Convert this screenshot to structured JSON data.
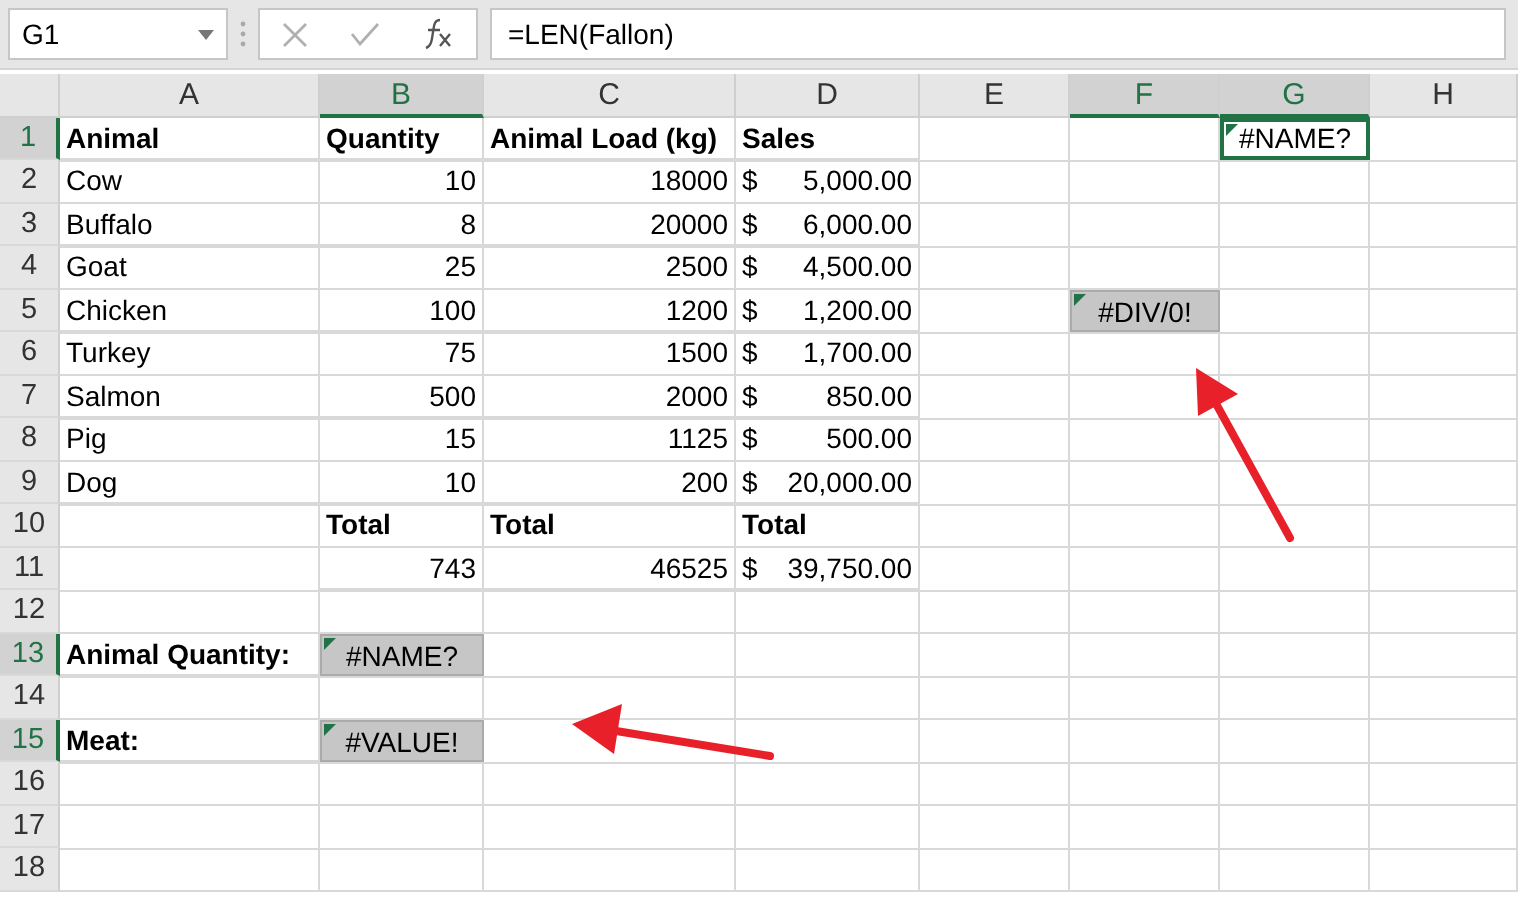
{
  "name_box": {
    "value": "G1"
  },
  "formula_bar": {
    "value": "=LEN(Fallon)"
  },
  "columns": [
    {
      "label": "A",
      "selected": false
    },
    {
      "label": "B",
      "selected": true
    },
    {
      "label": "C",
      "selected": false
    },
    {
      "label": "D",
      "selected": false
    },
    {
      "label": "E",
      "selected": false
    },
    {
      "label": "F",
      "selected": true
    },
    {
      "label": "G",
      "selected": true
    },
    {
      "label": "H",
      "selected": false
    }
  ],
  "rows": [
    {
      "number": "1",
      "selected": true,
      "cells": [
        {
          "kind": "label",
          "text": "Animal",
          "selected": false
        },
        {
          "kind": "label",
          "text": "Quantity",
          "selected": false
        },
        {
          "kind": "label",
          "text": "Animal Load (kg)",
          "selected": false
        },
        {
          "kind": "label",
          "text": "Sales",
          "selected": false
        },
        {
          "selected": false
        },
        {
          "selected": false
        },
        {
          "kind": "error",
          "text": "#NAME?",
          "selected": true
        },
        {
          "selected": false
        }
      ]
    },
    {
      "number": "2",
      "selected": false,
      "cells": [
        {
          "kind": "text",
          "text": "Cow",
          "selected": false
        },
        {
          "kind": "number",
          "text": "10",
          "selected": false
        },
        {
          "kind": "number",
          "text": "18000",
          "selected": false
        },
        {
          "kind": "currency",
          "symbol": "$",
          "text": "5,000.00",
          "selected": false
        },
        {
          "selected": false
        },
        {
          "selected": false
        },
        {
          "selected": false
        },
        {
          "selected": false
        }
      ]
    },
    {
      "number": "3",
      "selected": false,
      "cells": [
        {
          "kind": "text",
          "text": "Buffalo",
          "selected": false
        },
        {
          "kind": "number",
          "text": "8",
          "selected": false
        },
        {
          "kind": "number",
          "text": "20000",
          "selected": false
        },
        {
          "kind": "currency",
          "symbol": "$",
          "text": "6,000.00",
          "selected": false
        },
        {
          "selected": false
        },
        {
          "selected": false
        },
        {
          "selected": false
        },
        {
          "selected": false
        }
      ]
    },
    {
      "number": "4",
      "selected": false,
      "cells": [
        {
          "kind": "text",
          "text": "Goat",
          "selected": false
        },
        {
          "kind": "number",
          "text": "25",
          "selected": false
        },
        {
          "kind": "number",
          "text": "2500",
          "selected": false
        },
        {
          "kind": "currency",
          "symbol": "$",
          "text": "4,500.00",
          "selected": false
        },
        {
          "selected": false
        },
        {
          "selected": false
        },
        {
          "selected": false
        },
        {
          "selected": false
        }
      ]
    },
    {
      "number": "5",
      "selected": false,
      "cells": [
        {
          "kind": "text",
          "text": "Chicken",
          "selected": false
        },
        {
          "kind": "number",
          "text": "100",
          "selected": false
        },
        {
          "kind": "number",
          "text": "1200",
          "selected": false
        },
        {
          "kind": "currency",
          "symbol": "$",
          "text": "1,200.00",
          "selected": false
        },
        {
          "selected": false
        },
        {
          "kind": "error",
          "text": "#DIV/0!",
          "selected": false
        },
        {
          "selected": false
        },
        {
          "selected": false
        }
      ]
    },
    {
      "number": "6",
      "selected": false,
      "cells": [
        {
          "kind": "text",
          "text": "Turkey",
          "selected": false
        },
        {
          "kind": "number",
          "text": "75",
          "selected": false
        },
        {
          "kind": "number",
          "text": "1500",
          "selected": false
        },
        {
          "kind": "currency",
          "symbol": "$",
          "text": "1,700.00",
          "selected": false
        },
        {
          "selected": false
        },
        {
          "selected": false
        },
        {
          "selected": false
        },
        {
          "selected": false
        }
      ]
    },
    {
      "number": "7",
      "selected": false,
      "cells": [
        {
          "kind": "text",
          "text": "Salmon",
          "selected": false
        },
        {
          "kind": "number",
          "text": "500",
          "selected": false
        },
        {
          "kind": "number",
          "text": "2000",
          "selected": false
        },
        {
          "kind": "currency",
          "symbol": "$",
          "text": "850.00",
          "selected": false
        },
        {
          "selected": false
        },
        {
          "selected": false
        },
        {
          "selected": false
        },
        {
          "selected": false
        }
      ]
    },
    {
      "number": "8",
      "selected": false,
      "cells": [
        {
          "kind": "text",
          "text": "Pig",
          "selected": false
        },
        {
          "kind": "number",
          "text": "15",
          "selected": false
        },
        {
          "kind": "number",
          "text": "1125",
          "selected": false
        },
        {
          "kind": "currency",
          "symbol": "$",
          "text": "500.00",
          "selected": false
        },
        {
          "selected": false
        },
        {
          "selected": false
        },
        {
          "selected": false
        },
        {
          "selected": false
        }
      ]
    },
    {
      "number": "9",
      "selected": false,
      "cells": [
        {
          "kind": "text",
          "text": "Dog",
          "selected": false
        },
        {
          "kind": "number",
          "text": "10",
          "selected": false
        },
        {
          "kind": "number",
          "text": "200",
          "selected": false
        },
        {
          "kind": "currency",
          "symbol": "$",
          "text": "20,000.00",
          "selected": false
        },
        {
          "selected": false
        },
        {
          "selected": false
        },
        {
          "selected": false
        },
        {
          "selected": false
        }
      ]
    },
    {
      "number": "10",
      "selected": false,
      "cells": [
        {
          "selected": false
        },
        {
          "kind": "label",
          "text": "Total",
          "selected": false
        },
        {
          "kind": "label",
          "text": "Total",
          "selected": false
        },
        {
          "kind": "label",
          "text": "Total",
          "selected": false
        },
        {
          "selected": false
        },
        {
          "selected": false
        },
        {
          "selected": false
        },
        {
          "selected": false
        }
      ]
    },
    {
      "number": "11",
      "selected": false,
      "cells": [
        {
          "selected": false
        },
        {
          "kind": "number",
          "text": "743",
          "selected": false
        },
        {
          "kind": "number",
          "text": "46525",
          "selected": false
        },
        {
          "kind": "currency",
          "symbol": "$",
          "text": "39,750.00",
          "selected": false
        },
        {
          "selected": false
        },
        {
          "selected": false
        },
        {
          "selected": false
        },
        {
          "selected": false
        }
      ]
    },
    {
      "number": "12",
      "selected": false,
      "cells": [
        {
          "selected": false
        },
        {
          "selected": false
        },
        {
          "selected": false
        },
        {
          "selected": false
        },
        {
          "selected": false
        },
        {
          "selected": false
        },
        {
          "selected": false
        },
        {
          "selected": false
        }
      ]
    },
    {
      "number": "13",
      "selected": true,
      "cells": [
        {
          "kind": "label",
          "text": "Animal Quantity:",
          "selected": false
        },
        {
          "kind": "error",
          "text": "#NAME?",
          "selected": false
        },
        {
          "selected": false
        },
        {
          "selected": false
        },
        {
          "selected": false
        },
        {
          "selected": false
        },
        {
          "selected": false
        },
        {
          "selected": false
        }
      ]
    },
    {
      "number": "14",
      "selected": false,
      "cells": [
        {
          "selected": false
        },
        {
          "selected": false
        },
        {
          "selected": false
        },
        {
          "selected": false
        },
        {
          "selected": false
        },
        {
          "selected": false
        },
        {
          "selected": false
        },
        {
          "selected": false
        }
      ]
    },
    {
      "number": "15",
      "selected": true,
      "cells": [
        {
          "kind": "label",
          "text": "Meat:",
          "selected": false
        },
        {
          "kind": "error",
          "text": "#VALUE!",
          "selected": false
        },
        {
          "selected": false
        },
        {
          "selected": false
        },
        {
          "selected": false
        },
        {
          "selected": false
        },
        {
          "selected": false
        },
        {
          "selected": false
        }
      ]
    },
    {
      "number": "16",
      "selected": false,
      "cells": [
        {
          "selected": false
        },
        {
          "selected": false
        },
        {
          "selected": false
        },
        {
          "selected": false
        },
        {
          "selected": false
        },
        {
          "selected": false
        },
        {
          "selected": false
        },
        {
          "selected": false
        }
      ]
    },
    {
      "number": "17",
      "selected": false,
      "cells": [
        {
          "selected": false
        },
        {
          "selected": false
        },
        {
          "selected": false
        },
        {
          "selected": false
        },
        {
          "selected": false
        },
        {
          "selected": false
        },
        {
          "selected": false
        },
        {
          "selected": false
        }
      ]
    },
    {
      "number": "18",
      "selected": false,
      "cells": [
        {
          "selected": false
        },
        {
          "selected": false
        },
        {
          "selected": false
        },
        {
          "selected": false
        },
        {
          "selected": false
        },
        {
          "selected": false
        },
        {
          "selected": false
        },
        {
          "selected": false
        }
      ]
    }
  ]
}
